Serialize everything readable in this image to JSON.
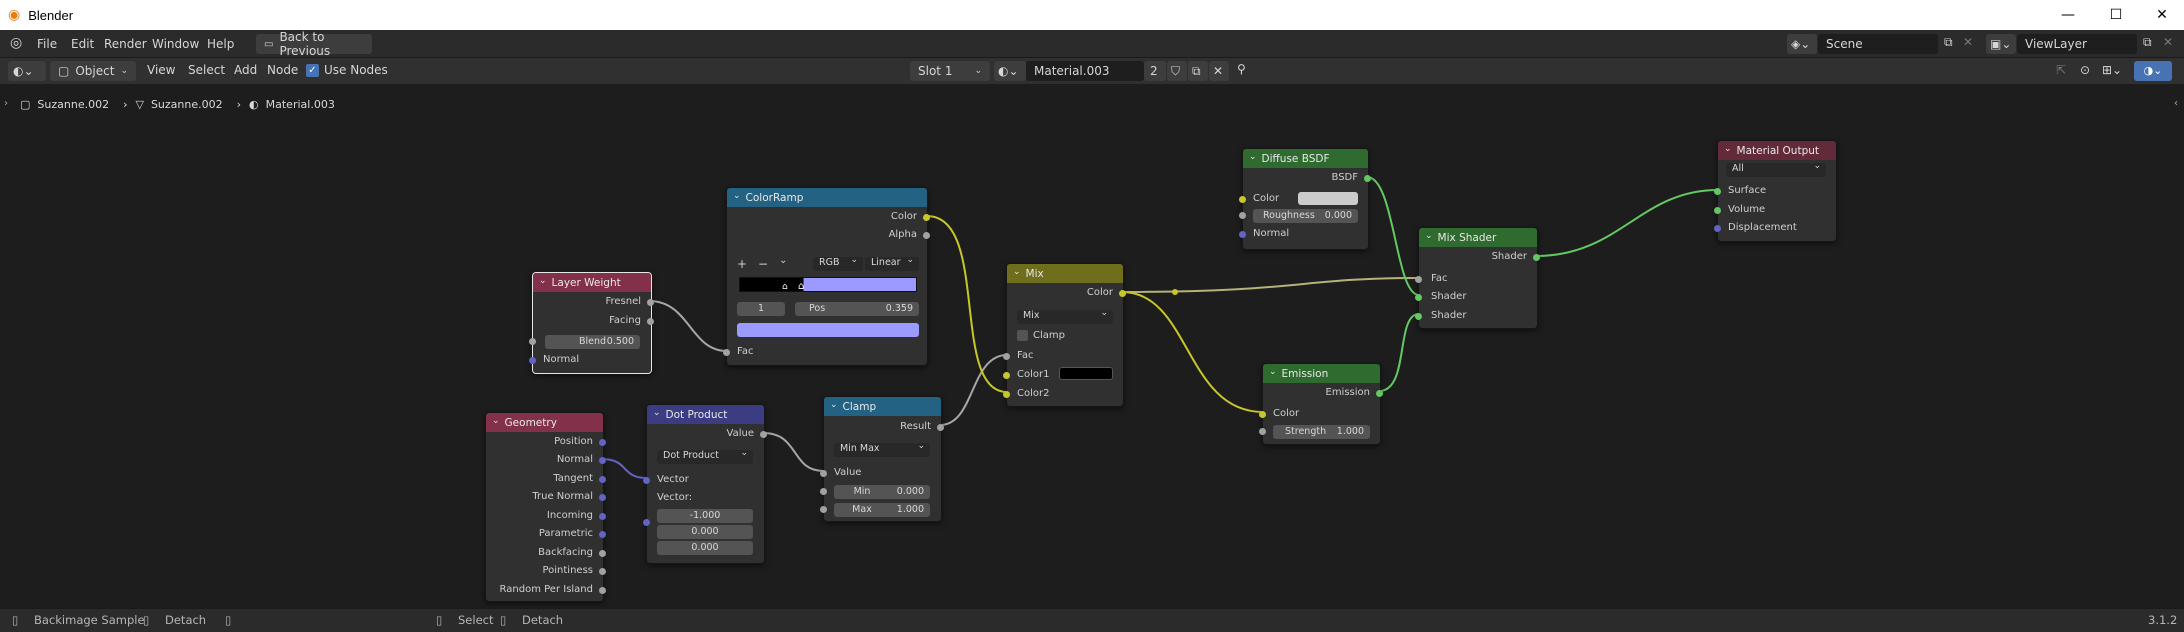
{
  "window": {
    "title": "Blender"
  },
  "topbar": {
    "menus": [
      "File",
      "Edit",
      "Render",
      "Window",
      "Help"
    ],
    "back_button": "Back to Previous",
    "scene": "Scene",
    "view_layer": "ViewLayer"
  },
  "header": {
    "mode": "Object",
    "menus": [
      "View",
      "Select",
      "Add",
      "Node"
    ],
    "use_nodes_label": "Use Nodes",
    "slot": "Slot 1",
    "material": "Material.003",
    "users": "2"
  },
  "breadcrumb": [
    "Suzanne.002",
    "Suzanne.002",
    "Material.003"
  ],
  "nodes": {
    "layer_weight": {
      "title": "Layer Weight",
      "out1": "Fresnel",
      "out2": "Facing",
      "blend_label": "Blend",
      "blend_value": "0.500",
      "normal": "Normal"
    },
    "colorramp": {
      "title": "ColorRamp",
      "out1": "Color",
      "out2": "Alpha",
      "mode": "RGB",
      "interp": "Linear",
      "index": "1",
      "pos_label": "Pos",
      "pos_value": "0.359",
      "fac": "Fac"
    },
    "geometry": {
      "title": "Geometry",
      "outputs": [
        "Position",
        "Normal",
        "Tangent",
        "True Normal",
        "Incoming",
        "Parametric",
        "Backfacing",
        "Pointiness",
        "Random Per Island"
      ]
    },
    "dot_product": {
      "title": "Dot Product",
      "out": "Value",
      "op": "Dot Product",
      "in1": "Vector",
      "in2": "Vector:",
      "v1": "-1.000",
      "v2": "0.000",
      "v3": "0.000"
    },
    "clamp": {
      "title": "Clamp",
      "out": "Result",
      "type": "Min Max",
      "value": "Value",
      "min_label": "Min",
      "min_value": "0.000",
      "max_label": "Max",
      "max_value": "1.000"
    },
    "mix": {
      "title": "Mix",
      "out": "Color",
      "blend": "Mix",
      "clamp": "Clamp",
      "fac": "Fac",
      "c1": "Color1",
      "c2": "Color2"
    },
    "diffuse": {
      "title": "Diffuse BSDF",
      "out": "BSDF",
      "color": "Color",
      "rough_label": "Roughness",
      "rough_value": "0.000",
      "normal": "Normal"
    },
    "emission": {
      "title": "Emission",
      "out": "Emission",
      "color": "Color",
      "strength_label": "Strength",
      "strength_value": "1.000"
    },
    "mix_shader": {
      "title": "Mix Shader",
      "out": "Shader",
      "fac": "Fac",
      "s1": "Shader",
      "s2": "Shader"
    },
    "output": {
      "title": "Material Output",
      "target": "All",
      "surface": "Surface",
      "volume": "Volume",
      "displacement": "Displacement"
    }
  },
  "status": {
    "left1": "Backimage Sample",
    "left2": "Detach",
    "mid1": "Select",
    "mid2": "Detach",
    "version": "3.1.2"
  },
  "colors": {
    "input_header": "#83314a",
    "converter_header": "#246283",
    "vector_header": "#3c3c83",
    "color_header": "#6e6e1d",
    "shader_header": "#2f6a2f",
    "output_header": "#632a3a"
  }
}
